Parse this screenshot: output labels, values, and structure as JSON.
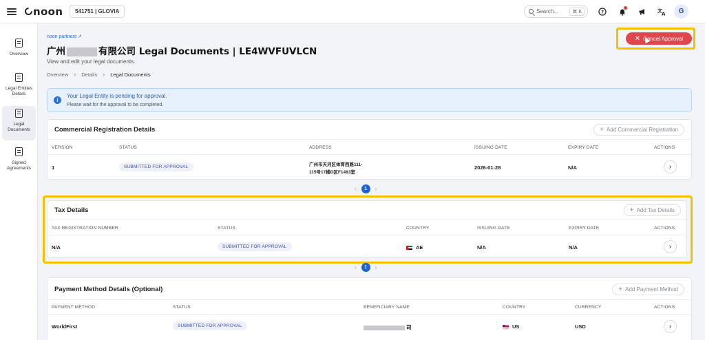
{
  "topbar": {
    "logo": "noon",
    "store": "541751 | GLOVIA",
    "search_placeholder": "Search...",
    "search_shortcut": "⌘ K",
    "avatar": "G",
    "icons": [
      "help-icon",
      "bell-icon",
      "megaphone-icon",
      "translate-icon"
    ]
  },
  "sidebar": {
    "items": [
      {
        "label": "Overview",
        "icon": "clipboard-icon",
        "active": false
      },
      {
        "label": "Legal Entities Details",
        "icon": "document-search-icon",
        "active": false
      },
      {
        "label": "Legal Documents",
        "icon": "documents-icon",
        "active": true
      },
      {
        "label": "Signed Agreements",
        "icon": "signed-document-icon",
        "active": false
      }
    ]
  },
  "header": {
    "partners_link": "noon partners ↗",
    "title_prefix": "广州",
    "title_suffix": "有限公司 Legal Documents | LE4WVFUVLCN",
    "subtitle": "View and edit your legal documents.",
    "breadcrumb": [
      "Overview",
      "Details",
      "Legal Documents"
    ],
    "cancel_label": "Cancel Approval"
  },
  "alert": {
    "title": "Your Legal Entity is pending for approval.",
    "message": "Please wait for the approval to be completed."
  },
  "commercial": {
    "title": "Commercial Registration Details",
    "add_label": "Add Commercial Registration",
    "headers": [
      "VERSION",
      "STATUS",
      "ADDRESS",
      "ISSUING DATE",
      "EXPIRY DATE",
      "ACTIONS"
    ],
    "row": {
      "version": "1",
      "status": "SUBMITTED FOR APPROVAL",
      "address_line1": "广州市天河区体育西路111-",
      "address_line2": "115号17楼D区F1483室",
      "issuing_date": "2026-01-28",
      "expiry_date": "N/A"
    },
    "page": "1"
  },
  "tax": {
    "title": "Tax Details",
    "add_label": "Add Tax Details",
    "headers": [
      "TAX REGISTRATION NUMBER",
      "STATUS",
      "COUNTRY",
      "ISSUING DATE",
      "EXPIRY DATE",
      "ACTIONS"
    ],
    "row": {
      "number": "N/A",
      "status": "SUBMITTED FOR APPROVAL",
      "country": "AE",
      "issuing_date": "N/A",
      "expiry_date": "N/A"
    },
    "page": "1"
  },
  "payment": {
    "title": "Payment Method Details (Optional)",
    "add_label": "Add Payment Method",
    "headers": [
      "PAYMENT METHOD",
      "STATUS",
      "BENEFICIARY NAME",
      "COUNTRY",
      "CURRENCY",
      "ACTIONS"
    ],
    "row": {
      "method": "WorldFirst",
      "status": "SUBMITTED FOR APPROVAL",
      "beneficiary_suffix": "司",
      "country": "US",
      "currency": "USD"
    }
  },
  "colors": {
    "accent": "#1f63d3",
    "danger": "#e0474c",
    "highlight": "#f2c100"
  }
}
